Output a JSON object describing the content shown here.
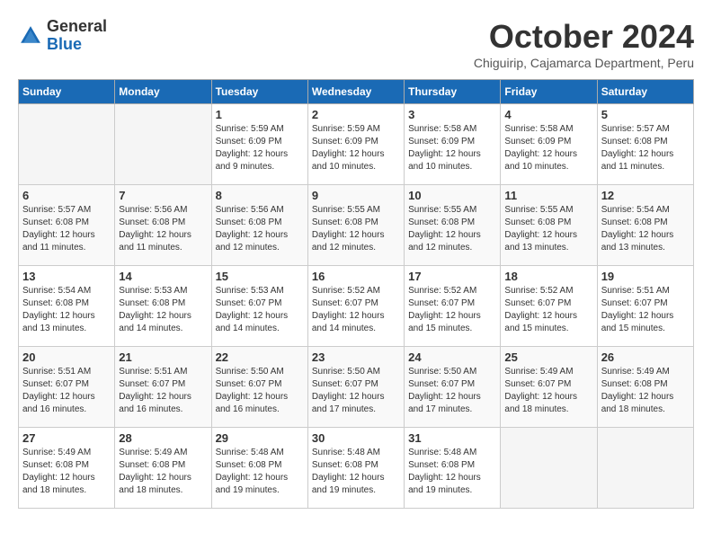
{
  "header": {
    "logo_general": "General",
    "logo_blue": "Blue",
    "month_title": "October 2024",
    "subtitle": "Chiguirip, Cajamarca Department, Peru"
  },
  "days_of_week": [
    "Sunday",
    "Monday",
    "Tuesday",
    "Wednesday",
    "Thursday",
    "Friday",
    "Saturday"
  ],
  "weeks": [
    [
      {
        "day": "",
        "info": ""
      },
      {
        "day": "",
        "info": ""
      },
      {
        "day": "1",
        "info": "Sunrise: 5:59 AM\nSunset: 6:09 PM\nDaylight: 12 hours and 9 minutes."
      },
      {
        "day": "2",
        "info": "Sunrise: 5:59 AM\nSunset: 6:09 PM\nDaylight: 12 hours and 10 minutes."
      },
      {
        "day": "3",
        "info": "Sunrise: 5:58 AM\nSunset: 6:09 PM\nDaylight: 12 hours and 10 minutes."
      },
      {
        "day": "4",
        "info": "Sunrise: 5:58 AM\nSunset: 6:09 PM\nDaylight: 12 hours and 10 minutes."
      },
      {
        "day": "5",
        "info": "Sunrise: 5:57 AM\nSunset: 6:08 PM\nDaylight: 12 hours and 11 minutes."
      }
    ],
    [
      {
        "day": "6",
        "info": "Sunrise: 5:57 AM\nSunset: 6:08 PM\nDaylight: 12 hours and 11 minutes."
      },
      {
        "day": "7",
        "info": "Sunrise: 5:56 AM\nSunset: 6:08 PM\nDaylight: 12 hours and 11 minutes."
      },
      {
        "day": "8",
        "info": "Sunrise: 5:56 AM\nSunset: 6:08 PM\nDaylight: 12 hours and 12 minutes."
      },
      {
        "day": "9",
        "info": "Sunrise: 5:55 AM\nSunset: 6:08 PM\nDaylight: 12 hours and 12 minutes."
      },
      {
        "day": "10",
        "info": "Sunrise: 5:55 AM\nSunset: 6:08 PM\nDaylight: 12 hours and 12 minutes."
      },
      {
        "day": "11",
        "info": "Sunrise: 5:55 AM\nSunset: 6:08 PM\nDaylight: 12 hours and 13 minutes."
      },
      {
        "day": "12",
        "info": "Sunrise: 5:54 AM\nSunset: 6:08 PM\nDaylight: 12 hours and 13 minutes."
      }
    ],
    [
      {
        "day": "13",
        "info": "Sunrise: 5:54 AM\nSunset: 6:08 PM\nDaylight: 12 hours and 13 minutes."
      },
      {
        "day": "14",
        "info": "Sunrise: 5:53 AM\nSunset: 6:08 PM\nDaylight: 12 hours and 14 minutes."
      },
      {
        "day": "15",
        "info": "Sunrise: 5:53 AM\nSunset: 6:07 PM\nDaylight: 12 hours and 14 minutes."
      },
      {
        "day": "16",
        "info": "Sunrise: 5:52 AM\nSunset: 6:07 PM\nDaylight: 12 hours and 14 minutes."
      },
      {
        "day": "17",
        "info": "Sunrise: 5:52 AM\nSunset: 6:07 PM\nDaylight: 12 hours and 15 minutes."
      },
      {
        "day": "18",
        "info": "Sunrise: 5:52 AM\nSunset: 6:07 PM\nDaylight: 12 hours and 15 minutes."
      },
      {
        "day": "19",
        "info": "Sunrise: 5:51 AM\nSunset: 6:07 PM\nDaylight: 12 hours and 15 minutes."
      }
    ],
    [
      {
        "day": "20",
        "info": "Sunrise: 5:51 AM\nSunset: 6:07 PM\nDaylight: 12 hours and 16 minutes."
      },
      {
        "day": "21",
        "info": "Sunrise: 5:51 AM\nSunset: 6:07 PM\nDaylight: 12 hours and 16 minutes."
      },
      {
        "day": "22",
        "info": "Sunrise: 5:50 AM\nSunset: 6:07 PM\nDaylight: 12 hours and 16 minutes."
      },
      {
        "day": "23",
        "info": "Sunrise: 5:50 AM\nSunset: 6:07 PM\nDaylight: 12 hours and 17 minutes."
      },
      {
        "day": "24",
        "info": "Sunrise: 5:50 AM\nSunset: 6:07 PM\nDaylight: 12 hours and 17 minutes."
      },
      {
        "day": "25",
        "info": "Sunrise: 5:49 AM\nSunset: 6:07 PM\nDaylight: 12 hours and 18 minutes."
      },
      {
        "day": "26",
        "info": "Sunrise: 5:49 AM\nSunset: 6:08 PM\nDaylight: 12 hours and 18 minutes."
      }
    ],
    [
      {
        "day": "27",
        "info": "Sunrise: 5:49 AM\nSunset: 6:08 PM\nDaylight: 12 hours and 18 minutes."
      },
      {
        "day": "28",
        "info": "Sunrise: 5:49 AM\nSunset: 6:08 PM\nDaylight: 12 hours and 18 minutes."
      },
      {
        "day": "29",
        "info": "Sunrise: 5:48 AM\nSunset: 6:08 PM\nDaylight: 12 hours and 19 minutes."
      },
      {
        "day": "30",
        "info": "Sunrise: 5:48 AM\nSunset: 6:08 PM\nDaylight: 12 hours and 19 minutes."
      },
      {
        "day": "31",
        "info": "Sunrise: 5:48 AM\nSunset: 6:08 PM\nDaylight: 12 hours and 19 minutes."
      },
      {
        "day": "",
        "info": ""
      },
      {
        "day": "",
        "info": ""
      }
    ]
  ]
}
